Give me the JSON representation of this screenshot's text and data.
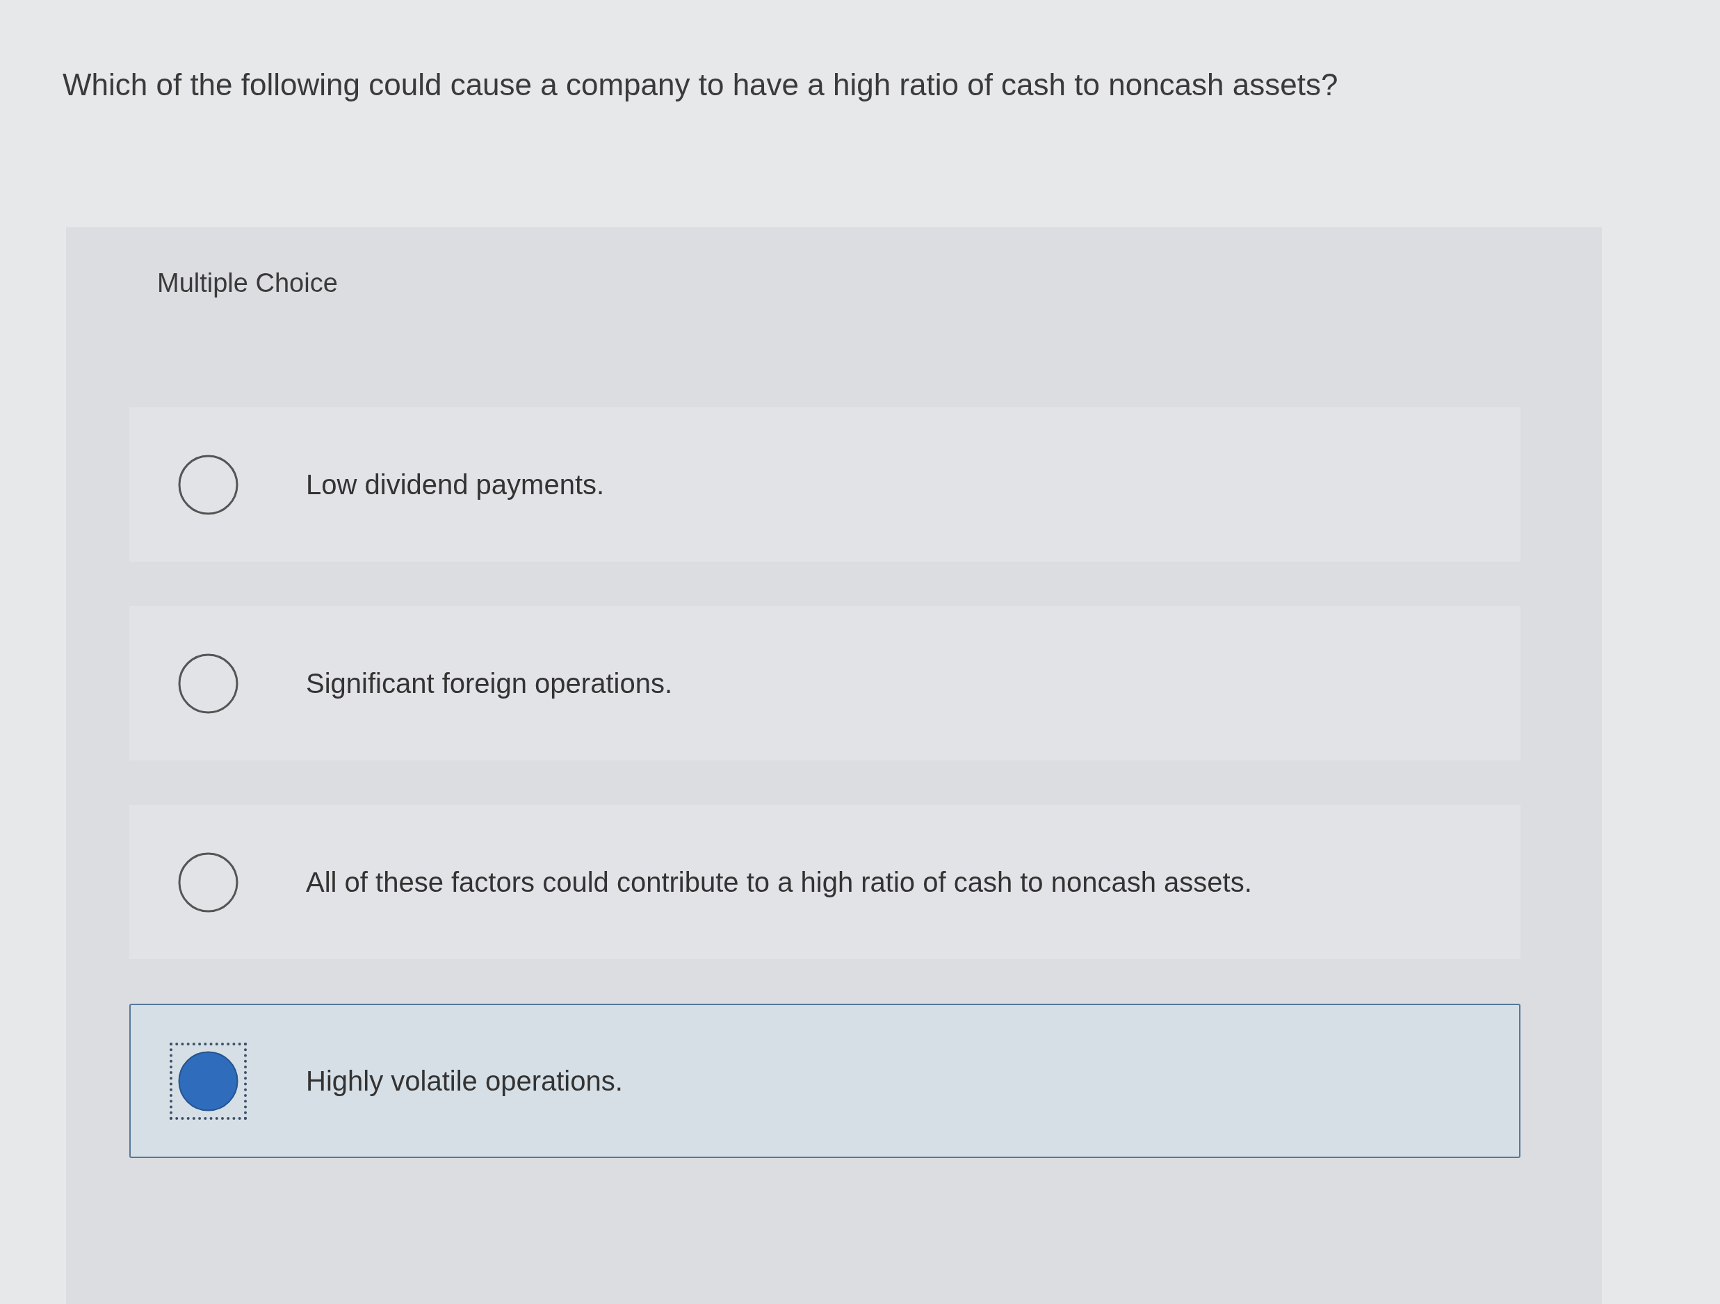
{
  "question": "Which of the following could cause a company to have a high ratio of cash to noncash assets?",
  "choice": {
    "heading": "Multiple Choice",
    "options": [
      {
        "label": "Low dividend payments.",
        "selected": false
      },
      {
        "label": "Significant foreign operations.",
        "selected": false
      },
      {
        "label": "All of these factors could contribute to a high ratio of cash to noncash assets.",
        "selected": false
      },
      {
        "label": "Highly volatile operations.",
        "selected": true
      }
    ]
  }
}
